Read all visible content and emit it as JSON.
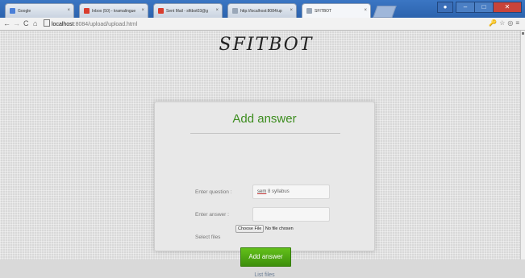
{
  "browser": {
    "tabs": [
      {
        "label": "Google",
        "fav_color": "#4a7fd8"
      },
      {
        "label": "Inbox (50) - kramalingue",
        "fav_color": "#d93d2e"
      },
      {
        "label": "Sent Mail - sfitbot03@g",
        "fav_color": "#d93d2e"
      },
      {
        "label": "http://localhost:8084/up",
        "fav_color": "#9aa7b8"
      },
      {
        "label": "SFITBOT",
        "fav_color": "#9aa7b8"
      }
    ],
    "url_host": "localhost",
    "url_path": ":8084/upload/upload.html",
    "icons": [
      "back-icon",
      "forward-icon",
      "reload-icon",
      "home-icon",
      "page-icon",
      "star-icon",
      "menu-icon"
    ]
  },
  "page": {
    "brand": "SFITBOT",
    "form": {
      "title": "Add answer",
      "question_label": "Enter question :",
      "question_value_spellcheck": "sem",
      "question_value_rest": " 8 syllabus",
      "answer_label": "Enter answer :",
      "file_label": "Select files",
      "choose_file_button": "Choose File",
      "no_file_text": "No file chosen",
      "submit_label": "Add answer",
      "list_link": "List files"
    }
  },
  "colors": {
    "accent_green": "#3d8d1f",
    "button_green": "#4ea711",
    "browser_blue": "#2c63ad",
    "close_red": "#c8443a"
  }
}
